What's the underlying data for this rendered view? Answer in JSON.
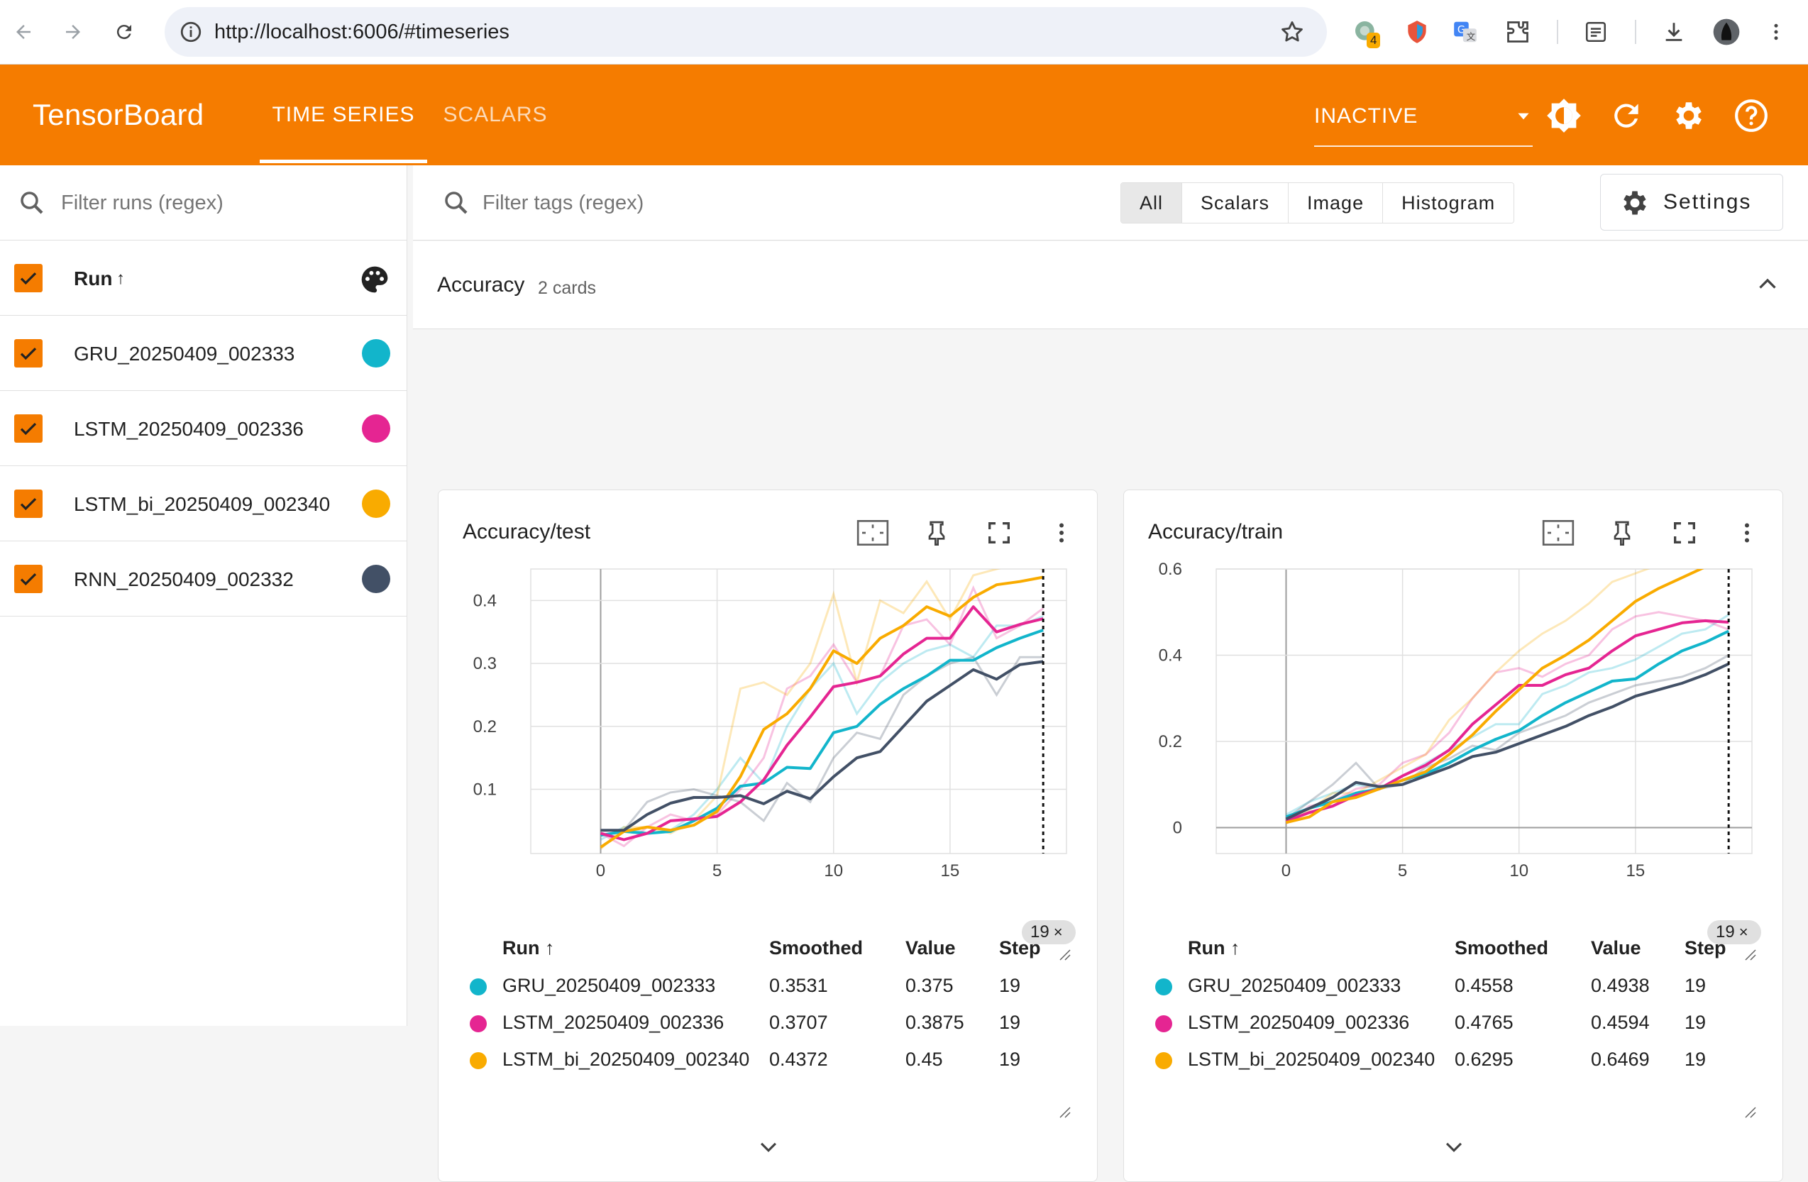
{
  "browser": {
    "url": "http://localhost:6006/#timeseries",
    "extension_badge": "4"
  },
  "header": {
    "title": "TensorBoard",
    "tabs": [
      {
        "label": "TIME SERIES",
        "active": true
      },
      {
        "label": "SCALARS",
        "active": false
      }
    ],
    "reload_status": "INACTIVE",
    "color": "#f57c00"
  },
  "sidebar": {
    "filter_placeholder": "Filter runs (regex)",
    "column_label": "Run",
    "sort_indicator": "↑",
    "runs": [
      {
        "name": "GRU_20250409_002333",
        "color": "#12b5cb",
        "checked": true
      },
      {
        "name": "LSTM_20250409_002336",
        "color": "#e52592",
        "checked": true
      },
      {
        "name": "LSTM_bi_20250409_002340",
        "color": "#f9ab00",
        "checked": true
      },
      {
        "name": "RNN_20250409_002332",
        "color": "#425066",
        "checked": true
      }
    ]
  },
  "toolbar": {
    "tag_filter_placeholder": "Filter tags (regex)",
    "type_filters": [
      "All",
      "Scalars",
      "Image",
      "Histogram"
    ],
    "active_type_filter": "All",
    "settings_label": "Settings"
  },
  "group": {
    "title": "Accuracy",
    "count_label": "2 cards"
  },
  "cards": [
    {
      "title": "Accuracy/test",
      "step_chip": "19",
      "legend_headers": {
        "run": "Run ↑",
        "smoothed": "Smoothed",
        "value": "Value",
        "step": "Step"
      },
      "legend_rows": [
        {
          "run": "GRU_20250409_002333",
          "smoothed": "0.3531",
          "value": "0.375",
          "step": "19",
          "color": "#12b5cb"
        },
        {
          "run": "LSTM_20250409_002336",
          "smoothed": "0.3707",
          "value": "0.3875",
          "step": "19",
          "color": "#e52592"
        },
        {
          "run": "LSTM_bi_20250409_002340",
          "smoothed": "0.4372",
          "value": "0.45",
          "step": "19",
          "color": "#f9ab00"
        }
      ]
    },
    {
      "title": "Accuracy/train",
      "step_chip": "19",
      "legend_headers": {
        "run": "Run ↑",
        "smoothed": "Smoothed",
        "value": "Value",
        "step": "Step"
      },
      "legend_rows": [
        {
          "run": "GRU_20250409_002333",
          "smoothed": "0.4558",
          "value": "0.4938",
          "step": "19",
          "color": "#12b5cb"
        },
        {
          "run": "LSTM_20250409_002336",
          "smoothed": "0.4765",
          "value": "0.4594",
          "step": "19",
          "color": "#e52592"
        },
        {
          "run": "LSTM_bi_20250409_002340",
          "smoothed": "0.6295",
          "value": "0.6469",
          "step": "19",
          "color": "#f9ab00"
        }
      ]
    }
  ],
  "chart_data": [
    {
      "type": "line",
      "title": "Accuracy/test",
      "x_ticks": [
        "0",
        "5",
        "10",
        "15"
      ],
      "y_ticks": [
        "0.1",
        "0.2",
        "0.3",
        "0.4"
      ],
      "xlim": [
        -3,
        20
      ],
      "ylim": [
        -0.002,
        0.45
      ],
      "selected_step": 19,
      "grid": true,
      "x": [
        0,
        1,
        2,
        3,
        4,
        5,
        6,
        7,
        8,
        9,
        10,
        11,
        12,
        13,
        14,
        15,
        16,
        17,
        18,
        19
      ],
      "series": [
        {
          "name": "GRU_20250409_002333",
          "color": "#12b5cb",
          "smoothed": [
            0.027,
            0.033,
            0.03,
            0.033,
            0.05,
            0.07,
            0.105,
            0.11,
            0.135,
            0.133,
            0.19,
            0.2,
            0.235,
            0.26,
            0.28,
            0.305,
            0.305,
            0.325,
            0.34,
            0.353
          ],
          "raw": [
            0.02,
            0.04,
            0.03,
            0.035,
            0.06,
            0.1,
            0.15,
            0.11,
            0.2,
            0.26,
            0.3,
            0.22,
            0.27,
            0.3,
            0.32,
            0.33,
            0.31,
            0.36,
            0.36,
            0.375
          ]
        },
        {
          "name": "LSTM_20250409_002336",
          "color": "#e52592",
          "smoothed": [
            0.03,
            0.02,
            0.03,
            0.05,
            0.053,
            0.057,
            0.08,
            0.115,
            0.17,
            0.215,
            0.263,
            0.27,
            0.28,
            0.315,
            0.34,
            0.34,
            0.39,
            0.35,
            0.362,
            0.371
          ],
          "raw": [
            0.03,
            0.01,
            0.04,
            0.06,
            0.05,
            0.06,
            0.1,
            0.15,
            0.26,
            0.28,
            0.33,
            0.27,
            0.28,
            0.36,
            0.37,
            0.33,
            0.42,
            0.34,
            0.36,
            0.3875
          ]
        },
        {
          "name": "LSTM_bi_20250409_002340",
          "color": "#f9ab00",
          "smoothed": [
            0.008,
            0.033,
            0.04,
            0.035,
            0.043,
            0.065,
            0.12,
            0.195,
            0.22,
            0.26,
            0.32,
            0.3,
            0.34,
            0.36,
            0.39,
            0.375,
            0.405,
            0.425,
            0.43,
            0.437
          ],
          "raw": [
            0.005,
            0.04,
            0.04,
            0.03,
            0.05,
            0.09,
            0.26,
            0.27,
            0.25,
            0.3,
            0.41,
            0.27,
            0.4,
            0.38,
            0.43,
            0.37,
            0.44,
            0.45,
            0.46,
            0.45
          ]
        },
        {
          "name": "RNN_20250409_002332",
          "color": "#425066",
          "smoothed": [
            0.035,
            0.035,
            0.06,
            0.078,
            0.087,
            0.087,
            0.09,
            0.077,
            0.097,
            0.085,
            0.12,
            0.15,
            0.16,
            0.2,
            0.24,
            0.265,
            0.29,
            0.275,
            0.298,
            0.303
          ],
          "raw": [
            0.035,
            0.035,
            0.08,
            0.095,
            0.1,
            0.09,
            0.08,
            0.05,
            0.11,
            0.08,
            0.15,
            0.19,
            0.18,
            0.25,
            0.28,
            0.3,
            0.31,
            0.25,
            0.31,
            0.31
          ]
        }
      ]
    },
    {
      "type": "line",
      "title": "Accuracy/train",
      "x_ticks": [
        "0",
        "5",
        "10",
        "15"
      ],
      "y_ticks": [
        "0",
        "0.2",
        "0.4",
        "0.6"
      ],
      "xlim": [
        -3,
        20
      ],
      "ylim": [
        -0.06,
        0.6
      ],
      "selected_step": 19,
      "grid": true,
      "x": [
        0,
        1,
        2,
        3,
        4,
        5,
        6,
        7,
        8,
        9,
        10,
        11,
        12,
        13,
        14,
        15,
        16,
        17,
        18,
        19
      ],
      "series": [
        {
          "name": "GRU_20250409_002333",
          "color": "#12b5cb",
          "smoothed": [
            0.025,
            0.045,
            0.06,
            0.08,
            0.09,
            0.11,
            0.125,
            0.15,
            0.18,
            0.205,
            0.225,
            0.26,
            0.29,
            0.315,
            0.34,
            0.345,
            0.38,
            0.41,
            0.43,
            0.456
          ],
          "raw": [
            0.03,
            0.06,
            0.08,
            0.1,
            0.09,
            0.12,
            0.15,
            0.18,
            0.21,
            0.24,
            0.24,
            0.31,
            0.33,
            0.36,
            0.37,
            0.39,
            0.42,
            0.45,
            0.46,
            0.4938
          ]
        },
        {
          "name": "LSTM_20250409_002336",
          "color": "#e52592",
          "smoothed": [
            0.015,
            0.035,
            0.05,
            0.075,
            0.09,
            0.12,
            0.145,
            0.18,
            0.24,
            0.285,
            0.33,
            0.33,
            0.355,
            0.37,
            0.41,
            0.445,
            0.46,
            0.475,
            0.48,
            0.4765
          ],
          "raw": [
            0.01,
            0.05,
            0.06,
            0.09,
            0.1,
            0.15,
            0.17,
            0.22,
            0.3,
            0.36,
            0.37,
            0.35,
            0.38,
            0.4,
            0.46,
            0.49,
            0.5,
            0.49,
            0.48,
            0.4594
          ]
        },
        {
          "name": "LSTM_bi_20250409_002340",
          "color": "#f9ab00",
          "smoothed": [
            0.012,
            0.025,
            0.06,
            0.07,
            0.09,
            0.11,
            0.13,
            0.17,
            0.215,
            0.27,
            0.32,
            0.37,
            0.4,
            0.435,
            0.48,
            0.525,
            0.555,
            0.58,
            0.605,
            0.6295
          ],
          "raw": [
            0.01,
            0.04,
            0.08,
            0.08,
            0.11,
            0.14,
            0.17,
            0.25,
            0.3,
            0.36,
            0.41,
            0.45,
            0.48,
            0.52,
            0.57,
            0.59,
            0.61,
            0.63,
            0.64,
            0.6469
          ]
        },
        {
          "name": "RNN_20250409_002332",
          "color": "#425066",
          "smoothed": [
            0.02,
            0.045,
            0.07,
            0.105,
            0.095,
            0.1,
            0.12,
            0.14,
            0.165,
            0.175,
            0.195,
            0.215,
            0.235,
            0.26,
            0.28,
            0.305,
            0.32,
            0.335,
            0.355,
            0.38
          ],
          "raw": [
            0.02,
            0.06,
            0.1,
            0.15,
            0.09,
            0.1,
            0.14,
            0.16,
            0.19,
            0.18,
            0.22,
            0.24,
            0.26,
            0.29,
            0.31,
            0.33,
            0.34,
            0.35,
            0.37,
            0.4
          ]
        }
      ]
    }
  ]
}
